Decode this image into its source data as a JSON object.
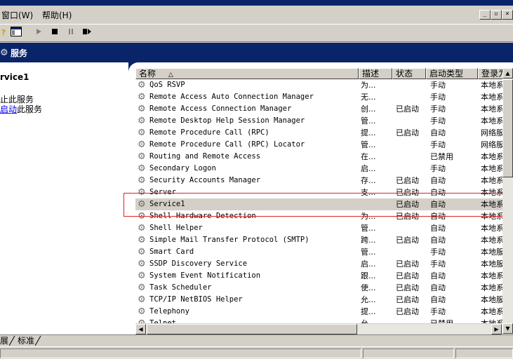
{
  "menu": {
    "window": "窗口(W)",
    "help": "帮助(H)"
  },
  "window_controls": {
    "minimize": "_",
    "restore": "▫",
    "close": "×"
  },
  "header": {
    "title": "服务"
  },
  "left_pane": {
    "service_name": "rvice1",
    "line1": "止此服务",
    "line2_link": "启动",
    "line2_rest": "此服务"
  },
  "columns": {
    "name": "名称",
    "sort_arrow": "△",
    "desc": "描述",
    "status": "状态",
    "startup": "启动类型",
    "logon": "登录为"
  },
  "services": [
    {
      "name": "QoS RSVP",
      "desc": "为...",
      "status": "",
      "startup": "手动",
      "logon": "本地系"
    },
    {
      "name": "Remote Access Auto Connection Manager",
      "desc": "无...",
      "status": "",
      "startup": "手动",
      "logon": "本地系"
    },
    {
      "name": "Remote Access Connection Manager",
      "desc": "创...",
      "status": "已启动",
      "startup": "手动",
      "logon": "本地系"
    },
    {
      "name": "Remote Desktop Help Session Manager",
      "desc": "管...",
      "status": "",
      "startup": "手动",
      "logon": "本地系"
    },
    {
      "name": "Remote Procedure Call (RPC)",
      "desc": "提...",
      "status": "已启动",
      "startup": "自动",
      "logon": "网络服"
    },
    {
      "name": "Remote Procedure Call (RPC) Locator",
      "desc": "管...",
      "status": "",
      "startup": "手动",
      "logon": "网络服"
    },
    {
      "name": "Routing and Remote Access",
      "desc": "在...",
      "status": "",
      "startup": "已禁用",
      "logon": "本地系"
    },
    {
      "name": "Secondary Logon",
      "desc": "启...",
      "status": "",
      "startup": "手动",
      "logon": "本地系"
    },
    {
      "name": "Security Accounts Manager",
      "desc": "存...",
      "status": "已启动",
      "startup": "自动",
      "logon": "本地系"
    },
    {
      "name": "Server",
      "desc": "支...",
      "status": "已启动",
      "startup": "自动",
      "logon": "本地系"
    },
    {
      "name": "Service1",
      "desc": "",
      "status": "已启动",
      "startup": "自动",
      "logon": "本地系"
    },
    {
      "name": "Shell Hardware Detection",
      "desc": "为...",
      "status": "已启动",
      "startup": "自动",
      "logon": "本地系"
    },
    {
      "name": "Shell Helper",
      "desc": "管...",
      "status": "",
      "startup": "自动",
      "logon": "本地系"
    },
    {
      "name": "Simple Mail Transfer Protocol (SMTP)",
      "desc": "跨...",
      "status": "已启动",
      "startup": "自动",
      "logon": "本地系"
    },
    {
      "name": "Smart Card",
      "desc": "管...",
      "status": "",
      "startup": "手动",
      "logon": "本地服"
    },
    {
      "name": "SSDP Discovery Service",
      "desc": "启...",
      "status": "已启动",
      "startup": "手动",
      "logon": "本地服"
    },
    {
      "name": "System Event Notification",
      "desc": "跟...",
      "status": "已启动",
      "startup": "自动",
      "logon": "本地系"
    },
    {
      "name": "Task Scheduler",
      "desc": "使...",
      "status": "已启动",
      "startup": "自动",
      "logon": "本地系"
    },
    {
      "name": "TCP/IP NetBIOS Helper",
      "desc": "允...",
      "status": "已启动",
      "startup": "自动",
      "logon": "本地服"
    },
    {
      "name": "Telephony",
      "desc": "提...",
      "status": "已启动",
      "startup": "手动",
      "logon": "本地系"
    },
    {
      "name": "Telnet",
      "desc": "允...",
      "status": "",
      "startup": "已禁用",
      "logon": "本地系"
    }
  ],
  "tabs": {
    "extended": "展",
    "standard": "标准"
  },
  "colors": {
    "header_bg": "#0a246a",
    "highlight_box": "#e02020",
    "selected_row": "#d4d0c8"
  },
  "icons": {
    "service": "gear-icon"
  }
}
